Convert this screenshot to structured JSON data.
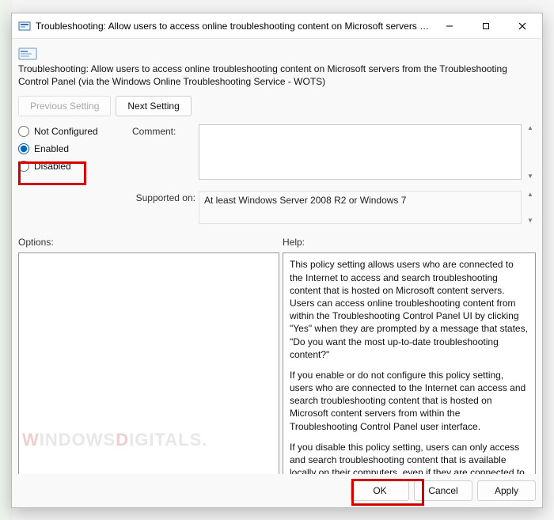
{
  "window": {
    "title": "Troubleshooting: Allow users to access online troubleshooting content on Microsoft servers fro..."
  },
  "description": "Troubleshooting: Allow users to access online troubleshooting content on Microsoft servers from the Troubleshooting Control Panel (via the Windows Online Troubleshooting Service - WOTS)",
  "nav": {
    "previous": "Previous Setting",
    "next": "Next Setting"
  },
  "state": {
    "not_configured": "Not Configured",
    "enabled": "Enabled",
    "disabled": "Disabled",
    "selected": "enabled"
  },
  "labels": {
    "comment": "Comment:",
    "supported": "Supported on:",
    "options": "Options:",
    "help": "Help:"
  },
  "supported_text": "At least Windows Server 2008 R2 or Windows 7",
  "help_paragraphs": [
    "This policy setting allows users who are connected to the Internet to access and search troubleshooting content that is hosted on Microsoft content servers. Users can access online troubleshooting content from within the Troubleshooting Control Panel UI by clicking \"Yes\" when they are prompted by a message that states, \"Do you want the most up-to-date troubleshooting content?\"",
    "If you enable or do not configure this policy setting, users who are connected to the Internet can access and search troubleshooting content that is hosted on Microsoft content servers from within the Troubleshooting Control Panel user interface.",
    "If you disable this policy setting, users can only access and search troubleshooting content that is available locally on their computers, even if they are connected to the Internet. They are"
  ],
  "footer": {
    "ok": "OK",
    "cancel": "Cancel",
    "apply": "Apply"
  },
  "watermark": {
    "part1": "W",
    "part2": "INDOWS",
    "part3": "D",
    "part4": "IGITALS."
  }
}
